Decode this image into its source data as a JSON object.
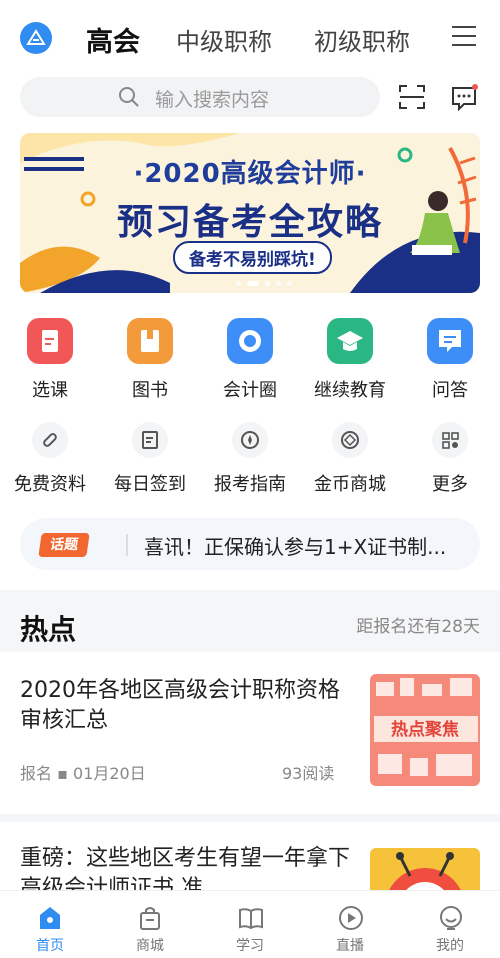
{
  "header": {
    "tabs": [
      {
        "label": "高会",
        "active": true
      },
      {
        "label": "中级职称",
        "active": false
      },
      {
        "label": "初级职称",
        "active": false
      }
    ]
  },
  "search": {
    "placeholder": "输入搜索内容"
  },
  "banner": {
    "line1": "·2020高级会计师·",
    "line2": "预习备考全攻略",
    "pill": "备考不易别踩坑!"
  },
  "grid_primary": [
    {
      "label": "选课",
      "icon": "course-icon",
      "color": "#f25757"
    },
    {
      "label": "图书",
      "icon": "book-icon",
      "color": "#f39a3b"
    },
    {
      "label": "会计圈",
      "icon": "circle-icon",
      "color": "#3e8ef7"
    },
    {
      "label": "继续教育",
      "icon": "graduation-icon",
      "color": "#2bb784"
    },
    {
      "label": "问答",
      "icon": "qa-icon",
      "color": "#3e8ef7"
    }
  ],
  "grid_secondary": [
    {
      "label": "免费资料",
      "icon": "link-icon"
    },
    {
      "label": "每日签到",
      "icon": "signin-icon"
    },
    {
      "label": "报考指南",
      "icon": "compass-icon"
    },
    {
      "label": "金币商城",
      "icon": "coin-icon"
    },
    {
      "label": "更多",
      "icon": "more-grid-icon"
    }
  ],
  "notice": {
    "tag": "话题",
    "text": "喜讯！正保确认参与1+X证书制..."
  },
  "hot": {
    "title": "热点",
    "meta": "距报名还有28天",
    "articles": [
      {
        "title": "2020年各地区高级会计职称资格审核汇总",
        "meta": "报名 ▪ 01月20日",
        "reads": "93阅读",
        "thumb_text": "热点聚焦"
      },
      {
        "title": "重磅：这些地区考生有望一年拿下高级会计师证书,准"
      }
    ]
  },
  "bottom_nav": [
    {
      "label": "首页",
      "active": true
    },
    {
      "label": "商城",
      "active": false
    },
    {
      "label": "学习",
      "active": false
    },
    {
      "label": "直播",
      "active": false
    },
    {
      "label": "我的",
      "active": false
    }
  ],
  "colors": {
    "accent": "#2f8cf0",
    "tag": "#f2672f",
    "banner_text": "#1a2f86"
  }
}
